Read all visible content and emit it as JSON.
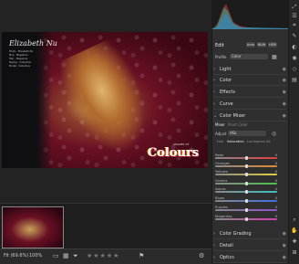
{
  "photo": {
    "title": "Elizabeth Nu",
    "credits": [
      "Photo · Elizabeth Nu",
      "Mua · Magazine",
      "Hair · Magazine",
      "Styling · Collective",
      "Model · Collective"
    ],
    "brand": "Colours",
    "brand_small": "SHADES OF"
  },
  "status": {
    "zoom_label": "Fit (69.6%)",
    "zoom_percent": "100%",
    "stars": "★★★★★"
  },
  "panel": {
    "edit_title": "Edit",
    "auto_button": "Auto",
    "bw_button": "B&W",
    "hdr_button": "HDR",
    "profile_label": "Profile",
    "profile_value": "Color",
    "sections_top": [
      "Light",
      "Color",
      "Effects",
      "Curve"
    ],
    "color_mixer": {
      "title": "Color Mixer",
      "tab_mixer": "Mixer",
      "tab_point": "Point Color",
      "adjust_label": "Adjust",
      "adjust_value": "HSL",
      "subtabs": [
        "Hue",
        "Saturation",
        "Luminance",
        "All"
      ],
      "sliders": [
        {
          "name": "Reds",
          "value": "0",
          "color": "#e04040"
        },
        {
          "name": "Oranges",
          "value": "0",
          "color": "#e08a30"
        },
        {
          "name": "Yellows",
          "value": "0",
          "color": "#e0d040"
        },
        {
          "name": "Greens",
          "value": "0",
          "color": "#50c050"
        },
        {
          "name": "Aquas",
          "value": "0",
          "color": "#40c0c0"
        },
        {
          "name": "Blues",
          "value": "0",
          "color": "#4070e0"
        },
        {
          "name": "Purples",
          "value": "0",
          "color": "#9050d0"
        },
        {
          "name": "Magentas",
          "value": "0",
          "color": "#d040b0"
        }
      ]
    },
    "sections_bottom": [
      "Color Grading",
      "Detail",
      "Optics"
    ]
  }
}
